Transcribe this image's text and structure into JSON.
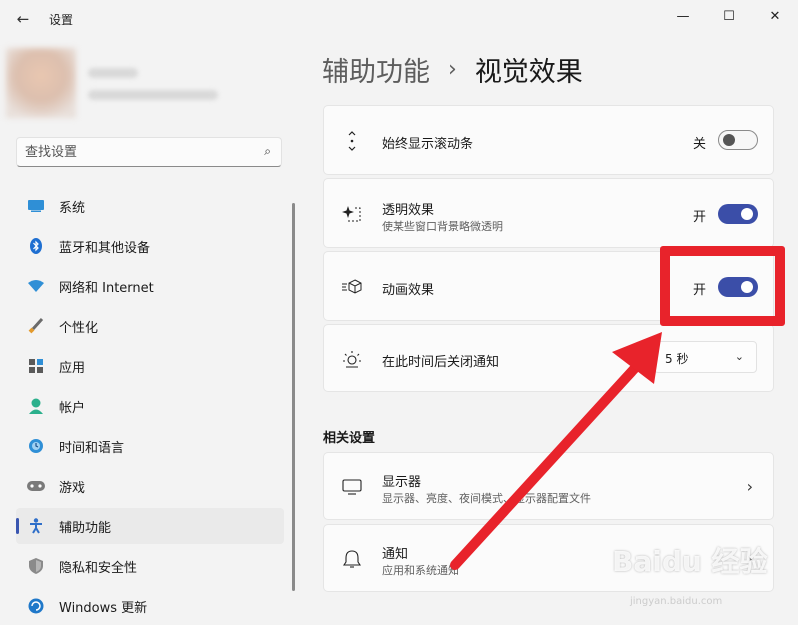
{
  "app": {
    "title": "设置",
    "back_icon": "back-arrow-icon"
  },
  "window_controls": {
    "minimize": "—",
    "maximize": "☐",
    "close": "✕"
  },
  "search": {
    "placeholder": "查找设置",
    "icon": "search-icon"
  },
  "nav": {
    "items": [
      {
        "label": "系统",
        "icon": "system-icon",
        "active": false
      },
      {
        "label": "蓝牙和其他设备",
        "icon": "bluetooth-icon",
        "active": false
      },
      {
        "label": "网络和 Internet",
        "icon": "network-icon",
        "active": false
      },
      {
        "label": "个性化",
        "icon": "personalization-brush-icon",
        "active": false
      },
      {
        "label": "应用",
        "icon": "apps-icon",
        "active": false
      },
      {
        "label": "帐户",
        "icon": "account-icon",
        "active": false
      },
      {
        "label": "时间和语言",
        "icon": "time-language-icon",
        "active": false
      },
      {
        "label": "游戏",
        "icon": "gamepad-icon",
        "active": false
      },
      {
        "label": "辅助功能",
        "icon": "accessibility-icon",
        "active": true
      },
      {
        "label": "隐私和安全性",
        "icon": "shield-icon",
        "active": false
      },
      {
        "label": "Windows 更新",
        "icon": "windows-update-icon",
        "active": false
      }
    ]
  },
  "breadcrumb": {
    "parent": "辅助功能",
    "separator": "›",
    "current": "视觉效果"
  },
  "settings": {
    "scrollbars": {
      "title": "始终显示滚动条",
      "state_label": "关",
      "on": false
    },
    "transparency": {
      "title": "透明效果",
      "subtitle": "使某些窗口背景略微透明",
      "state_label": "开",
      "on": true
    },
    "animation": {
      "title": "动画效果",
      "state_label": "开",
      "on": true
    },
    "notifications": {
      "title": "在此时间后关闭通知",
      "dropdown_value": "5 秒"
    }
  },
  "related": {
    "title": "相关设置",
    "display": {
      "title": "显示器",
      "subtitle": "显示器、亮度、夜间模式、显示器配置文件"
    },
    "notify": {
      "title": "通知",
      "subtitle": "应用和系统通知"
    }
  },
  "watermark": {
    "text": "Baidu 经验",
    "sub": "jingyan.baidu.com"
  },
  "colors": {
    "accent": "#3b4ea8",
    "annotation_red": "#e8232b",
    "background": "#f3f3f3",
    "card": "#fbfbfb"
  }
}
